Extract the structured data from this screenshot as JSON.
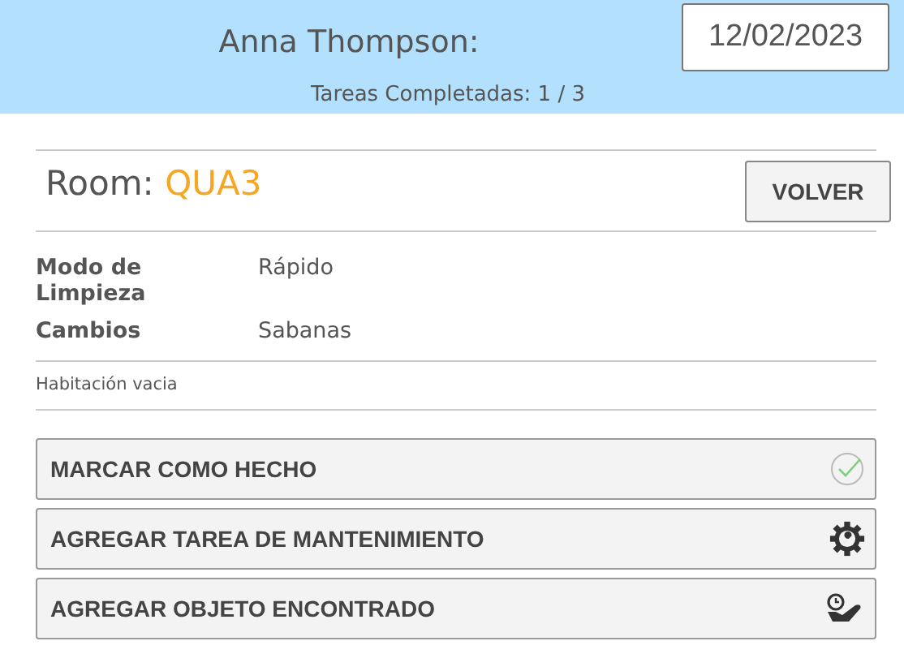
{
  "header": {
    "user": "Anna Thompson:",
    "date": "12/02/2023",
    "progress": "Tareas Completadas: 1 / 3"
  },
  "room": {
    "label": "Room:",
    "code": "QUA3",
    "back_button": "VOLVER"
  },
  "details": [
    {
      "label": "Modo de Limpieza",
      "value": "Rápido"
    },
    {
      "label": "Cambios",
      "value": "Sabanas"
    }
  ],
  "note": "Habitación vacia",
  "actions": [
    {
      "label": "MARCAR COMO HECHO",
      "kind": "done"
    },
    {
      "label": "AGREGAR TAREA DE MANTENIMIENTO",
      "kind": "maintenance"
    },
    {
      "label": "AGREGAR OBJETO ENCONTRADO",
      "kind": "found"
    }
  ]
}
